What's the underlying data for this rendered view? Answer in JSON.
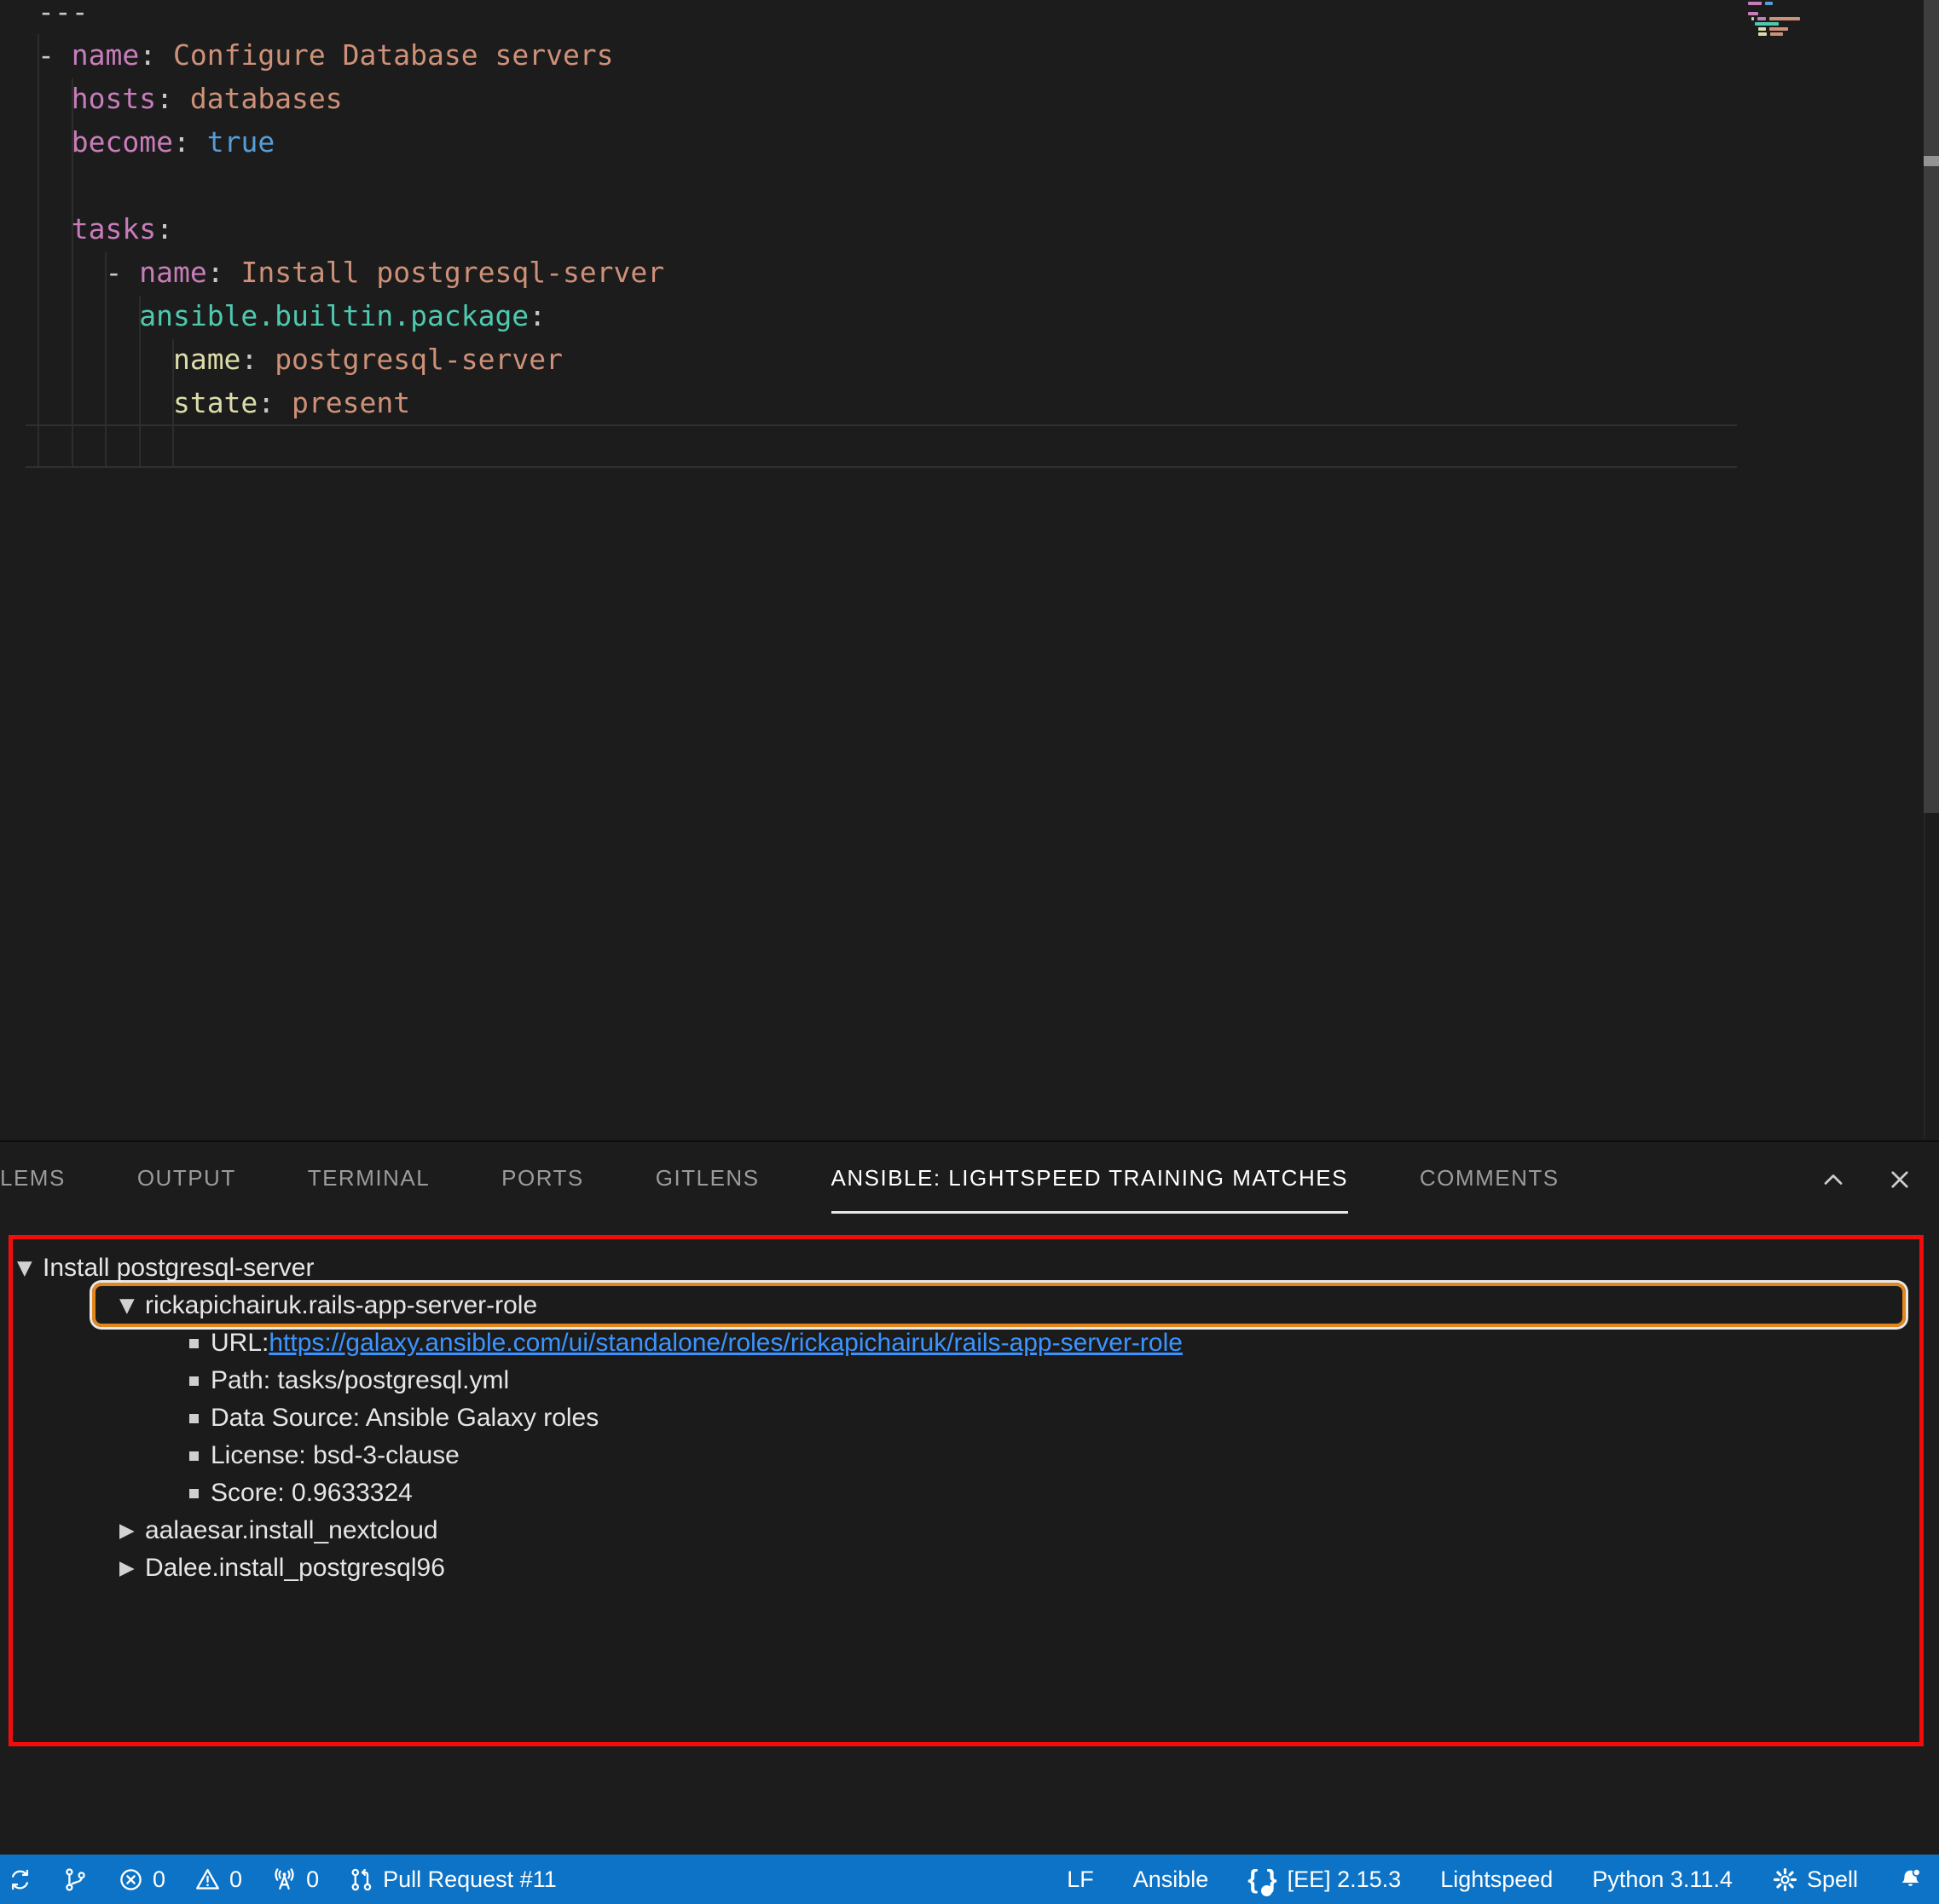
{
  "colors": {
    "status_bar": "#0D73C6",
    "link_blue": "#3B94FF",
    "focus_ring_orange": "#E2861E",
    "annotation_red": "#F40B0B",
    "syntax": {
      "key": "#C77DBA",
      "str": "#CE9178",
      "bool": "#569CD6",
      "fn": "#4EC9B0",
      "attr": "#DCDCAA",
      "punct": "#C8C8C8",
      "ws": "#C8C8C8"
    }
  },
  "editor": {
    "code_lines": [
      [
        {
          "t": "---",
          "c": "punct"
        }
      ],
      [
        {
          "t": "- ",
          "c": "punct"
        },
        {
          "t": "name",
          "c": "key"
        },
        {
          "t": ": ",
          "c": "punct"
        },
        {
          "t": "Configure Database servers",
          "c": "str"
        }
      ],
      [
        {
          "t": "  ",
          "c": "ws"
        },
        {
          "t": "hosts",
          "c": "key"
        },
        {
          "t": ": ",
          "c": "punct"
        },
        {
          "t": "databases",
          "c": "str"
        }
      ],
      [
        {
          "t": "  ",
          "c": "ws"
        },
        {
          "t": "become",
          "c": "key"
        },
        {
          "t": ": ",
          "c": "punct"
        },
        {
          "t": "true",
          "c": "bool"
        }
      ],
      [],
      [
        {
          "t": "  ",
          "c": "ws"
        },
        {
          "t": "tasks",
          "c": "key"
        },
        {
          "t": ":",
          "c": "punct"
        }
      ],
      [
        {
          "t": "    - ",
          "c": "punct"
        },
        {
          "t": "name",
          "c": "key"
        },
        {
          "t": ": ",
          "c": "punct"
        },
        {
          "t": "Install postgresql-server",
          "c": "str"
        }
      ],
      [
        {
          "t": "      ",
          "c": "ws"
        },
        {
          "t": "ansible.builtin.package",
          "c": "fn"
        },
        {
          "t": ":",
          "c": "punct"
        }
      ],
      [
        {
          "t": "        ",
          "c": "ws"
        },
        {
          "t": "name",
          "c": "attr"
        },
        {
          "t": ": ",
          "c": "punct"
        },
        {
          "t": "postgresql-server",
          "c": "str"
        }
      ],
      [
        {
          "t": "        ",
          "c": "ws"
        },
        {
          "t": "state",
          "c": "attr"
        },
        {
          "t": ": ",
          "c": "punct"
        },
        {
          "t": "present",
          "c": "str"
        }
      ]
    ],
    "minimap_rows": [
      {
        "i": 0,
        "s": [
          [
            "key",
            16
          ],
          [
            "bool",
            9
          ]
        ]
      },
      {
        "i": 0,
        "s": []
      },
      {
        "i": 0,
        "s": [
          [
            "key",
            12
          ]
        ]
      },
      {
        "i": 4,
        "s": [
          [
            "punct",
            3
          ],
          [
            "key",
            10
          ],
          [
            "str",
            36
          ]
        ]
      },
      {
        "i": 8,
        "s": [
          [
            "fn",
            28
          ]
        ]
      },
      {
        "i": 12,
        "s": [
          [
            "attr",
            9
          ],
          [
            "str",
            22
          ]
        ]
      },
      {
        "i": 12,
        "s": [
          [
            "attr",
            10
          ],
          [
            "str",
            15
          ]
        ]
      }
    ]
  },
  "panel": {
    "tabs": [
      {
        "label": "LEMS",
        "active": false
      },
      {
        "label": "OUTPUT",
        "active": false
      },
      {
        "label": "TERMINAL",
        "active": false
      },
      {
        "label": "PORTS",
        "active": false
      },
      {
        "label": "GITLENS",
        "active": false
      },
      {
        "label": "ANSIBLE: LIGHTSPEED TRAINING MATCHES",
        "active": true
      },
      {
        "label": "COMMENTS",
        "active": false
      }
    ],
    "actions": [
      "chevron-up",
      "close"
    ],
    "tree": [
      {
        "kind": "open",
        "indent": 0,
        "label": "Install postgresql-server",
        "focused": false
      },
      {
        "kind": "open",
        "indent": 1,
        "label": "rickapichairuk.rails-app-server-role",
        "focused": true
      },
      {
        "kind": "bullet",
        "indent": 2,
        "label": "URL: ",
        "link": "https://galaxy.ansible.com/ui/standalone/roles/rickapichairuk/rails-app-server-role",
        "focused": false
      },
      {
        "kind": "bullet",
        "indent": 2,
        "label": "Path: tasks/postgresql.yml",
        "focused": false
      },
      {
        "kind": "bullet",
        "indent": 2,
        "label": "Data Source: Ansible Galaxy roles",
        "focused": false
      },
      {
        "kind": "bullet",
        "indent": 2,
        "label": "License: bsd-3-clause",
        "focused": false
      },
      {
        "kind": "bullet",
        "indent": 2,
        "label": "Score: 0.9633324",
        "focused": false
      },
      {
        "kind": "closed",
        "indent": 1,
        "label": "aalaesar.install_nextcloud",
        "focused": false
      },
      {
        "kind": "closed",
        "indent": 1,
        "label": "Dalee.install_postgresql96",
        "focused": false
      }
    ]
  },
  "statusbar": {
    "left": [
      {
        "icon": "sync",
        "text": "",
        "name": "sync-status"
      },
      {
        "icon": "source-control",
        "text": "",
        "name": "source-control-graph"
      },
      {
        "icon": "error",
        "text": "0",
        "name": "errors-count"
      },
      {
        "icon": "warning",
        "text": "0",
        "name": "warnings-count"
      },
      {
        "icon": "broadcast",
        "text": "0",
        "name": "forwarded-ports"
      },
      {
        "icon": "pull-request",
        "text": "Pull Request #11",
        "name": "pull-request-status"
      }
    ],
    "right": [
      {
        "icon": "",
        "text": "LF",
        "name": "eol-indicator"
      },
      {
        "icon": "",
        "text": "Ansible",
        "name": "language-mode"
      },
      {
        "icon": "braces",
        "text": "[EE] 2.15.3",
        "name": "ansible-ee-version"
      },
      {
        "icon": "",
        "text": "Lightspeed",
        "name": "lightspeed-status"
      },
      {
        "icon": "",
        "text": "Python 3.11.4",
        "name": "python-version"
      },
      {
        "icon": "gear",
        "text": "Spell",
        "name": "spell-checker-status"
      },
      {
        "icon": "bell-dot",
        "text": "",
        "name": "notifications-bell"
      }
    ]
  }
}
